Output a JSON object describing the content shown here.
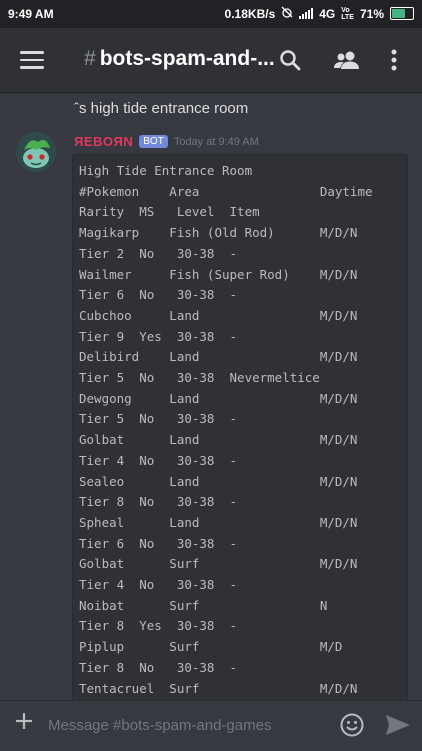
{
  "statusbar": {
    "time": "9:49 AM",
    "net_speed": "0.18KB/s",
    "network": "4G",
    "volte": "VoLTE",
    "battery": "71%",
    "battery_level": 0.71
  },
  "header": {
    "hash": "#",
    "channel_name": "bots-spam-and-..."
  },
  "previous_message": {
    "text": "ˆs high tide entrance room"
  },
  "message": {
    "username": "ЯEBOЯN",
    "bot_badge": "BOT",
    "timestamp": "Today at 9:49 AM",
    "lines": [
      "High Tide Entrance Room",
      "#Pokemon    Area                Daytime",
      "Rarity  MS   Level  Item",
      "Magikarp    Fish (Old Rod)      M/D/N",
      "Tier 2  No   30-38  -",
      "Wailmer     Fish (Super Rod)    M/D/N",
      "Tier 6  No   30-38  -",
      "Cubchoo     Land                M/D/N",
      "Tier 9  Yes  30-38  -",
      "Delibird    Land                M/D/N",
      "Tier 5  No   30-38  Nevermeltice",
      "Dewgong     Land                M/D/N",
      "Tier 5  No   30-38  -",
      "Golbat      Land                M/D/N",
      "Tier 4  No   30-38  -",
      "Sealeo      Land                M/D/N",
      "Tier 8  No   30-38  -",
      "Spheal      Land                M/D/N",
      "Tier 6  No   30-38  -",
      "Golbat      Surf                M/D/N",
      "Tier 4  No   30-38  -",
      "Noibat      Surf                N",
      "Tier 8  Yes  30-38  -",
      "Piplup      Surf                M/D",
      "Tier 8  No   30-38  -",
      "Tentacruel  Surf                M/D/N"
    ]
  },
  "input": {
    "placeholder": "Message #bots-spam-and-games"
  },
  "colors": {
    "background": "#36393f",
    "header": "#2f3136",
    "accent": "#7289da",
    "username": "#e23860"
  }
}
